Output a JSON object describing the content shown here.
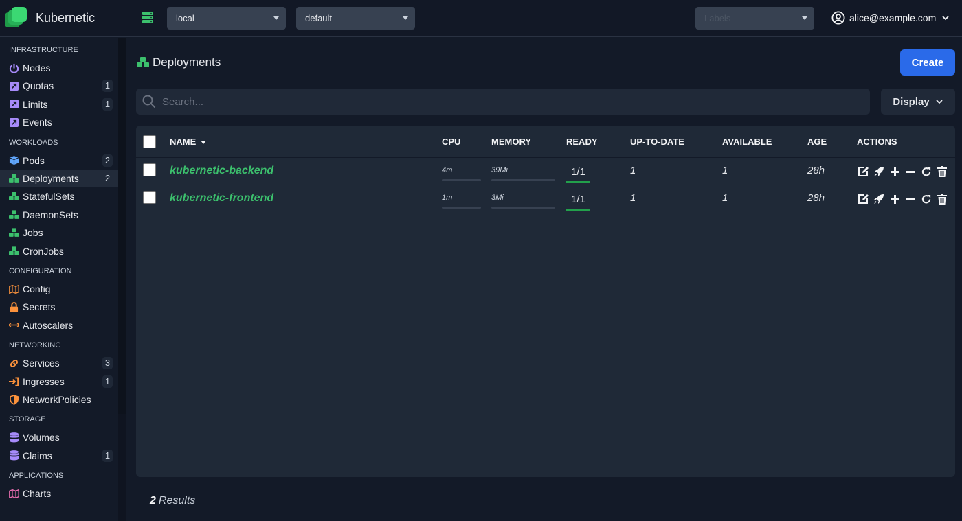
{
  "app": {
    "brand": "Kubernetic",
    "accent_color": "#2a6ae9",
    "brand_color": "#3cc06d"
  },
  "topbar": {
    "cluster_select": "local",
    "namespace_select": "default",
    "labels_placeholder": "Labels",
    "user": "alice@example.com"
  },
  "sidebar": {
    "sections": [
      {
        "title": "INFRASTRUCTURE",
        "items": [
          {
            "label": "Nodes",
            "icon": "power-icon",
            "badge": null
          },
          {
            "label": "Quotas",
            "icon": "external-link-square-icon",
            "badge": "1"
          },
          {
            "label": "Limits",
            "icon": "external-link-square-icon",
            "badge": "1"
          },
          {
            "label": "Events",
            "icon": "external-link-square-icon",
            "badge": null
          }
        ]
      },
      {
        "title": "WORKLOADS",
        "items": [
          {
            "label": "Pods",
            "icon": "cube-icon",
            "badge": "2"
          },
          {
            "label": "Deployments",
            "icon": "cubes-icon",
            "badge": "2",
            "active": true
          },
          {
            "label": "StatefulSets",
            "icon": "cubes-icon",
            "badge": null
          },
          {
            "label": "DaemonSets",
            "icon": "cubes-icon",
            "badge": null
          },
          {
            "label": "Jobs",
            "icon": "cubes-icon",
            "badge": null
          },
          {
            "label": "CronJobs",
            "icon": "cubes-icon",
            "badge": null
          }
        ]
      },
      {
        "title": "CONFIGURATION",
        "items": [
          {
            "label": "Config",
            "icon": "map-icon",
            "badge": null
          },
          {
            "label": "Secrets",
            "icon": "lock-icon",
            "badge": null
          },
          {
            "label": "Autoscalers",
            "icon": "arrows-horizontal-icon",
            "badge": null
          }
        ]
      },
      {
        "title": "NETWORKING",
        "items": [
          {
            "label": "Services",
            "icon": "link-icon",
            "badge": "3"
          },
          {
            "label": "Ingresses",
            "icon": "sign-in-icon",
            "badge": "1"
          },
          {
            "label": "NetworkPolicies",
            "icon": "shield-icon",
            "badge": null
          }
        ]
      },
      {
        "title": "STORAGE",
        "items": [
          {
            "label": "Volumes",
            "icon": "database-icon",
            "badge": null
          },
          {
            "label": "Claims",
            "icon": "database-icon",
            "badge": "1"
          }
        ]
      },
      {
        "title": "APPLICATIONS",
        "items": [
          {
            "label": "Charts",
            "icon": "map-icon",
            "badge": null
          }
        ]
      }
    ]
  },
  "main": {
    "title": "Deployments",
    "create_label": "Create",
    "search_placeholder": "Search...",
    "display_label": "Display",
    "columns": [
      "NAME",
      "CPU",
      "MEMORY",
      "READY",
      "UP-TO-DATE",
      "AVAILABLE",
      "AGE",
      "ACTIONS"
    ],
    "rows": [
      {
        "name": "kubernetic-backend",
        "cpu": "4m",
        "memory": "39Mi",
        "ready": "1/1",
        "ready_fraction": 1.0,
        "up_to_date": "1",
        "available": "1",
        "age": "28h"
      },
      {
        "name": "kubernetic-frontend",
        "cpu": "1m",
        "memory": "3Mi",
        "ready": "1/1",
        "ready_fraction": 1.0,
        "up_to_date": "1",
        "available": "1",
        "age": "28h"
      }
    ],
    "row_actions": [
      "edit-icon",
      "rocket-icon",
      "plus-icon",
      "minus-icon",
      "redo-icon",
      "trash-icon"
    ],
    "results_count": "2",
    "results_label": "Results"
  }
}
